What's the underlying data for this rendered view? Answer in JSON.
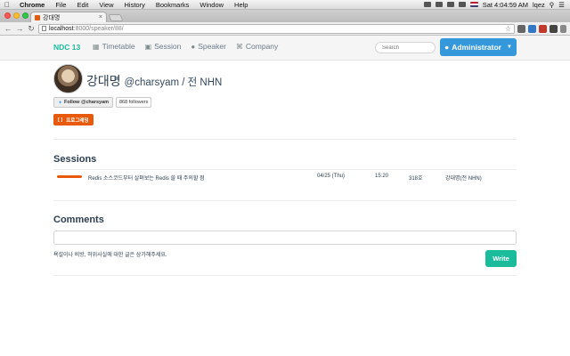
{
  "menubar": {
    "items": [
      "Chrome",
      "File",
      "Edit",
      "View",
      "History",
      "Bookmarks",
      "Window",
      "Help"
    ],
    "clock": "Sat 4:04:59 AM",
    "user": "lqez"
  },
  "browser": {
    "tab_title": "강대명",
    "url_host": "localhost",
    "url_path": ":8000/speaker/88/"
  },
  "navbar": {
    "brand": "NDC 13",
    "links": [
      {
        "label": "Timetable",
        "icon": "calendar-icon"
      },
      {
        "label": "Session",
        "icon": "video-camera-icon"
      },
      {
        "label": "Speaker",
        "icon": "user-icon"
      },
      {
        "label": "Company",
        "icon": "command-icon"
      }
    ],
    "search_placeholder": "Search",
    "admin_label": "Administrator"
  },
  "speaker": {
    "name": "강대명",
    "handle": "@charsyam / 전 NHN",
    "follow_label": "Follow @charsyam",
    "followers": "868 followers",
    "program_bracket": "[ ]",
    "program_label": "프로그래밍"
  },
  "sessions": {
    "title": "Sessions",
    "rows": [
      {
        "title": "Redis 소스코드부터 살펴보는 Redis 쓸 때 주의할 점",
        "date": "04/25 (Thu)",
        "time": "15:20",
        "room": "318호",
        "speaker": "강대명(전 NHN)"
      }
    ]
  },
  "comments": {
    "title": "Comments",
    "hint": "욕설이나 비방, 허위사실에 대한 글은 삼가해주세요.",
    "write_label": "Write"
  },
  "colors": {
    "brand": "#1abc9c",
    "admin": "#3498db",
    "accent": "#e8590c",
    "write": "#1abc9c"
  }
}
